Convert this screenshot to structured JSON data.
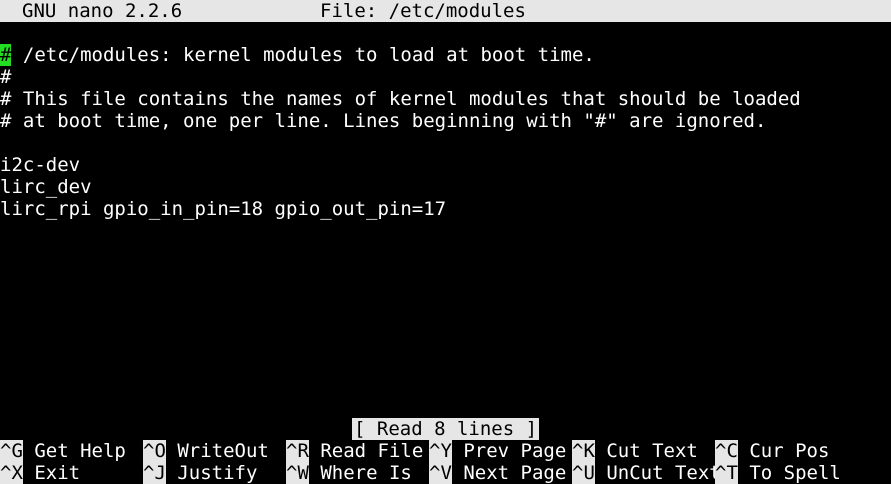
{
  "titlebar": {
    "app": "GNU nano 2.2.6",
    "file": "File: /etc/modules"
  },
  "editor": {
    "cursor_char": "#",
    "first_line_rest": " /etc/modules: kernel modules to load at boot time.",
    "lines": [
      "#",
      "# This file contains the names of kernel modules that should be loaded",
      "# at boot time, one per line. Lines beginning with \"#\" are ignored.",
      "",
      "i2c-dev",
      "lirc_dev",
      "lirc_rpi gpio_in_pin=18 gpio_out_pin=17"
    ]
  },
  "status": "[ Read 8 lines ]",
  "shortcuts": {
    "row1": [
      {
        "key": "^G",
        "label": " Get Help"
      },
      {
        "key": "^O",
        "label": " WriteOut"
      },
      {
        "key": "^R",
        "label": " Read File"
      },
      {
        "key": "^Y",
        "label": " Prev Page"
      },
      {
        "key": "^K",
        "label": " Cut Text"
      },
      {
        "key": "^C",
        "label": " Cur Pos"
      }
    ],
    "row2": [
      {
        "key": "^X",
        "label": " Exit"
      },
      {
        "key": "^J",
        "label": " Justify"
      },
      {
        "key": "^W",
        "label": " Where Is"
      },
      {
        "key": "^V",
        "label": " Next Page"
      },
      {
        "key": "^U",
        "label": " UnCut Text"
      },
      {
        "key": "^T",
        "label": " To Spell"
      }
    ]
  },
  "colors": {
    "background": "#000000",
    "text": "#ffffff",
    "inverse_bg": "#e6e6e6",
    "cursor": "#22dd22"
  }
}
